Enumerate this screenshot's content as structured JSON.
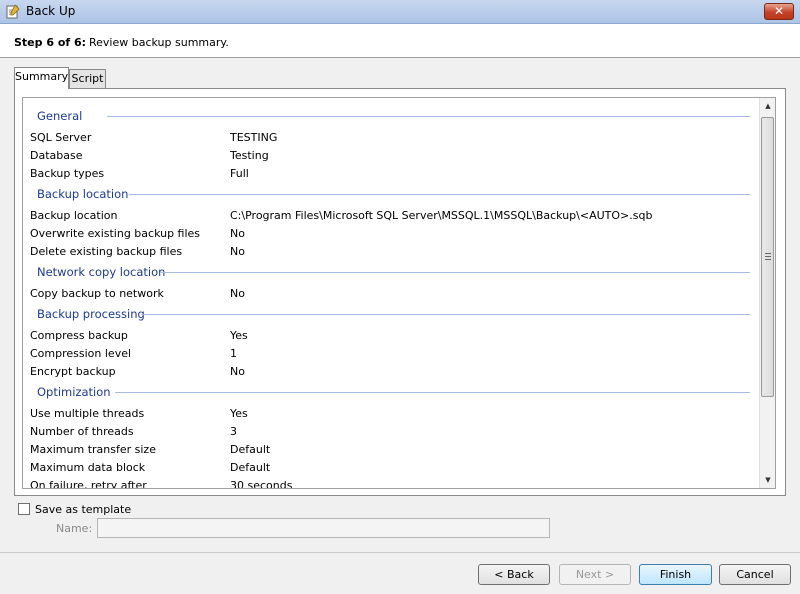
{
  "window": {
    "title": "Back Up",
    "close_glyph": "✕"
  },
  "step": {
    "label": "Step 6 of 6:",
    "description": "Review backup summary."
  },
  "tabs": [
    "Summary",
    "Script"
  ],
  "summary": {
    "general": {
      "title": "General",
      "rows": [
        {
          "label": "SQL Server",
          "value": "TESTING"
        },
        {
          "label": "Database",
          "value": "Testing"
        },
        {
          "label": "Backup types",
          "value": "Full"
        }
      ]
    },
    "backup_location": {
      "title": "Backup location",
      "rows": [
        {
          "label": "Backup location",
          "value": "C:\\Program Files\\Microsoft SQL Server\\MSSQL.1\\MSSQL\\Backup\\<AUTO>.sqb"
        },
        {
          "label": "Overwrite existing backup files",
          "value": "No"
        },
        {
          "label": "Delete existing backup files",
          "value": "No"
        }
      ]
    },
    "network_copy": {
      "title": "Network copy location",
      "rows": [
        {
          "label": "Copy backup to network",
          "value": "No"
        }
      ]
    },
    "processing": {
      "title": "Backup processing",
      "rows": [
        {
          "label": "Compress backup",
          "value": "Yes"
        },
        {
          "label": "Compression level",
          "value": "1"
        },
        {
          "label": "Encrypt backup",
          "value": "No"
        }
      ]
    },
    "optimization": {
      "title": "Optimization",
      "rows": [
        {
          "label": "Use multiple threads",
          "value": "Yes"
        },
        {
          "label": "Number of threads",
          "value": "3"
        },
        {
          "label": "Maximum transfer size",
          "value": "Default"
        },
        {
          "label": "Maximum data block",
          "value": "Default"
        },
        {
          "label": "On failure, retry after",
          "value": "30 seconds"
        }
      ]
    }
  },
  "template": {
    "checkbox_label": "Save as template",
    "name_label": "Name:",
    "name_value": "",
    "checked": false
  },
  "buttons": {
    "back": "< Back",
    "next": "Next >",
    "finish": "Finish",
    "cancel": "Cancel"
  },
  "scrollbar": {
    "up_glyph": "▲",
    "down_glyph": "▼"
  },
  "colors": {
    "section_header": "#1d3b8e",
    "close_button": "#c5432b"
  }
}
